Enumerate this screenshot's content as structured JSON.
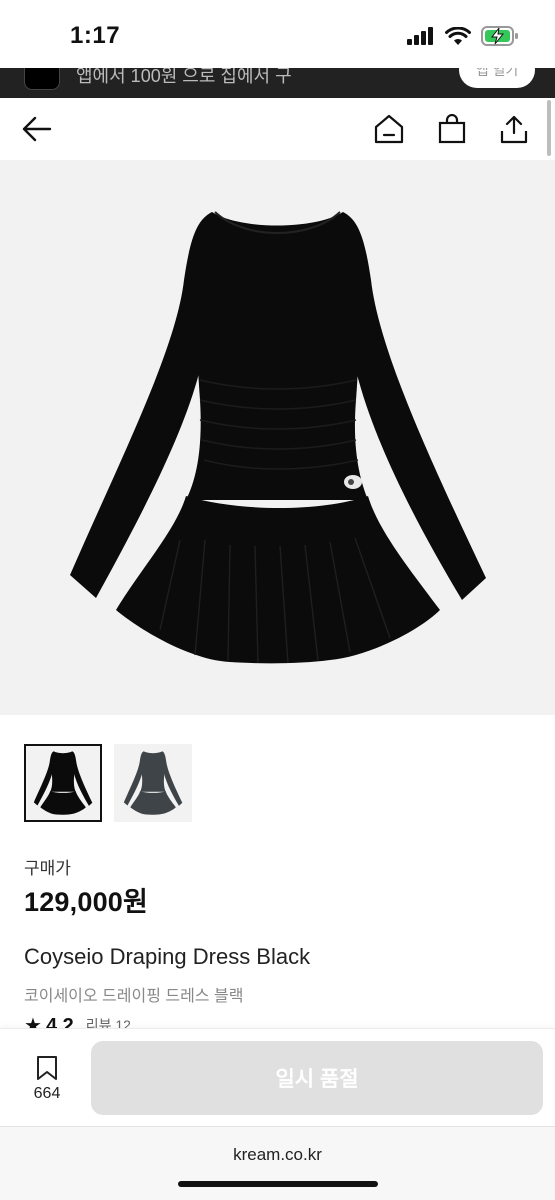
{
  "status_bar": {
    "time": "1:17",
    "icons": [
      "cellular-signal-icon",
      "wifi-icon",
      "battery-charging-icon"
    ]
  },
  "banner": {
    "text": "앱에서 100원 으로 집에서 구",
    "button_label": "앱 열기"
  },
  "nav": {
    "icons": [
      "back-arrow-icon",
      "home-icon",
      "shopping-bag-icon",
      "share-icon"
    ]
  },
  "product": {
    "price_label": "구매가",
    "price": "129,000원",
    "name_en": "Coyseio Draping Dress Black",
    "name_ko": "코이세이오 드레이핑 드레스 블랙",
    "rating": "4.2",
    "review_label": "리뷰 12",
    "thumbnails": [
      {
        "variant": "black",
        "selected": true
      },
      {
        "variant": "charcoal",
        "selected": false
      }
    ]
  },
  "bottom_bar": {
    "bookmark_count": "664",
    "action_label": "일시 품절"
  },
  "browser": {
    "url": "kream.co.kr"
  },
  "colors": {
    "sold_out_button": "#e0e0e0",
    "dress_black": "#0b0b0b",
    "dress_charcoal": "#3f4448",
    "battery_green": "#34c759"
  }
}
